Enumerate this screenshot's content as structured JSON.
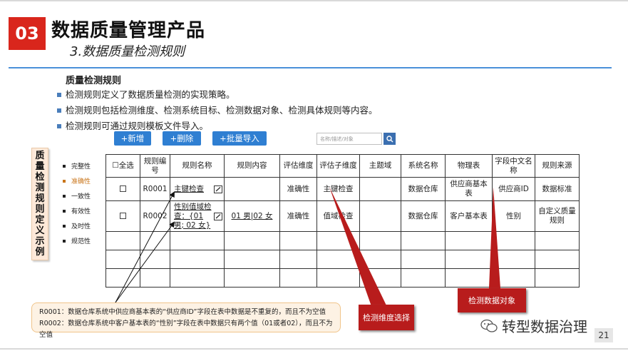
{
  "header": {
    "section_number": "03",
    "title": "数据质量管理产品",
    "subtitle": "3.数据质量检测规则"
  },
  "intro": {
    "heading": "质量检测规则",
    "bullets": [
      "检测规则定义了数据质量检测的实现策略。",
      "检测规则包括检测维度、检测系统目标、检测数据对象、检测具体规则等内容。",
      "检测规则可通过规则模板文件导入。"
    ]
  },
  "toolbar": {
    "add_label": "+新增",
    "delete_label": "+删除",
    "import_label": "+批量导入",
    "search_placeholder": "名称/描述/对象"
  },
  "side_label": [
    "质",
    "量",
    "检",
    "测",
    "规",
    "则",
    "定",
    "义",
    "示",
    "例"
  ],
  "dimensions": {
    "items": [
      "完整性",
      "准确性",
      "一致性",
      "有效性",
      "及时性",
      "规范性"
    ],
    "active_index": 1,
    "active_color": "#c9751a"
  },
  "table": {
    "headers": [
      "☐全选",
      "规则编号",
      "规则名称",
      "规则内容",
      "评估维度",
      "评估子维度",
      "主题域",
      "系统名称",
      "物理表",
      "字段中文名称",
      "规则来源"
    ],
    "rows": [
      {
        "id": "R0001",
        "name": "主键检查",
        "content": "",
        "dimension": "准确性",
        "sub_dimension": "主键检查",
        "subject_area": "",
        "system": "数据仓库",
        "table": "供应商基本表",
        "field": "供应商ID",
        "source": "数据标准"
      },
      {
        "id": "R0002",
        "name": "性别值域检查：{01 男; 02 女}",
        "content": "01 男|02 女",
        "dimension": "准确性",
        "sub_dimension": "值域检查",
        "subject_area": "",
        "system": "数据仓库",
        "table": "客户基本表",
        "field": "性别",
        "source": "自定义质量规则"
      }
    ]
  },
  "notes": [
    "R0001：数据仓库系统中供应商基本表的“供应商ID”字段在表中数据是不重复的，而且不为空值",
    "R0002：数据仓库系统中客户基本表的“性别”字段在表中数据只有两个值（01或者02），而且不为空值"
  ],
  "callouts": {
    "dimension_select": "检测维度选择",
    "data_object": "检测数据对象"
  },
  "watermark": "转型数据治理",
  "page_number": "21",
  "colors": {
    "accent_red": "#d9261c",
    "callout_red": "#b81c1c",
    "button_blue": "#2f7fd2",
    "rule_blue": "#4a90d9"
  }
}
